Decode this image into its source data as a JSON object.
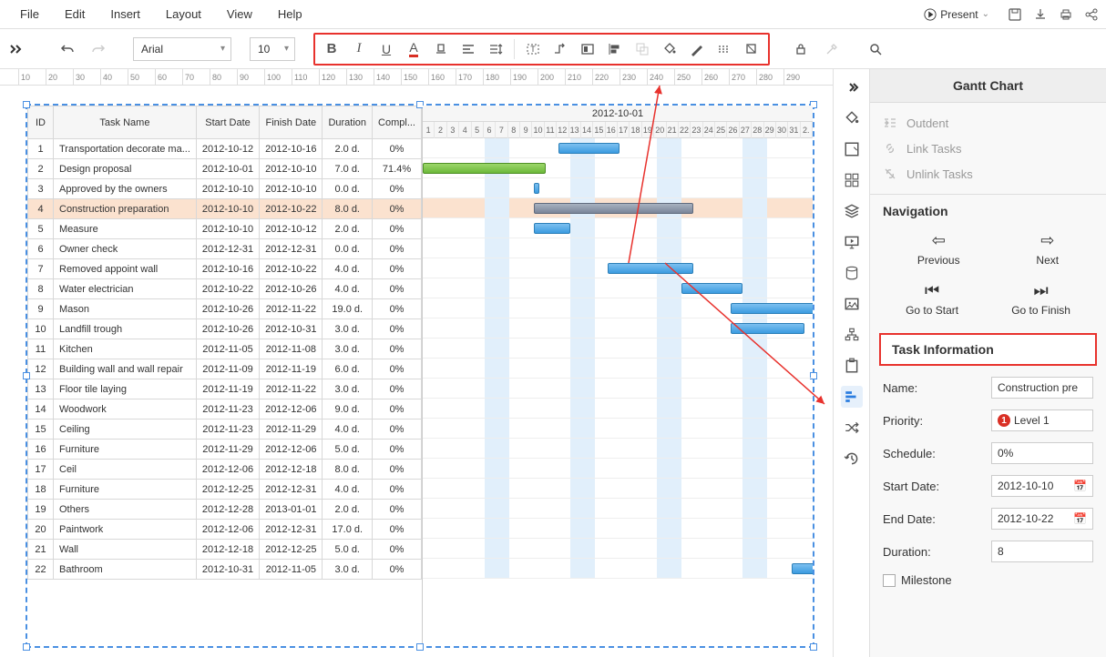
{
  "menu": {
    "file": "File",
    "edit": "Edit",
    "insert": "Insert",
    "layout": "Layout",
    "view": "View",
    "help": "Help",
    "present": "Present"
  },
  "toolbar": {
    "font": "Arial",
    "size": "10"
  },
  "ruler": [
    "10",
    "20",
    "30",
    "40",
    "50",
    "60",
    "70",
    "80",
    "90",
    "100",
    "110",
    "120",
    "130",
    "140",
    "150",
    "160",
    "170",
    "180",
    "190",
    "200",
    "210",
    "220",
    "230",
    "240",
    "250",
    "260",
    "270",
    "280",
    "290"
  ],
  "gantt": {
    "headers": {
      "id": "ID",
      "name": "Task Name",
      "start": "Start Date",
      "finish": "Finish Date",
      "duration": "Duration",
      "complete": "Compl..."
    },
    "month": "2012-10-01",
    "days": [
      "1",
      "2",
      "3",
      "4",
      "5",
      "6",
      "7",
      "8",
      "9",
      "10",
      "11",
      "12",
      "13",
      "14",
      "15",
      "16",
      "17",
      "18",
      "19",
      "20",
      "21",
      "22",
      "23",
      "24",
      "25",
      "26",
      "27",
      "28",
      "29",
      "30",
      "31"
    ],
    "rightEdgeDay": "2.",
    "rows": [
      {
        "id": "1",
        "name": "Transportation decorate ma...",
        "start": "2012-10-12",
        "finish": "2012-10-16",
        "dur": "2.0 d.",
        "comp": "0%",
        "barStart": 12,
        "barLen": 5,
        "barType": "blue"
      },
      {
        "id": "2",
        "name": "Design proposal",
        "start": "2012-10-01",
        "finish": "2012-10-10",
        "dur": "7.0 d.",
        "comp": "71.4%",
        "barStart": 1,
        "barLen": 10,
        "barType": "green"
      },
      {
        "id": "3",
        "name": "Approved by the owners",
        "start": "2012-10-10",
        "finish": "2012-10-10",
        "dur": "0.0 d.",
        "comp": "0%",
        "barStart": 10,
        "barLen": 0.5,
        "barType": "blue"
      },
      {
        "id": "4",
        "name": "Construction preparation",
        "start": "2012-10-10",
        "finish": "2012-10-22",
        "dur": "8.0 d.",
        "comp": "0%",
        "barStart": 10,
        "barLen": 13,
        "barType": "gray",
        "selected": true
      },
      {
        "id": "5",
        "name": "Measure",
        "start": "2012-10-10",
        "finish": "2012-10-12",
        "dur": "2.0 d.",
        "comp": "0%",
        "barStart": 10,
        "barLen": 3,
        "barType": "blue"
      },
      {
        "id": "6",
        "name": "Owner check",
        "start": "2012-12-31",
        "finish": "2012-12-31",
        "dur": "0.0 d.",
        "comp": "0%"
      },
      {
        "id": "7",
        "name": "Removed appoint wall",
        "start": "2012-10-16",
        "finish": "2012-10-22",
        "dur": "4.0 d.",
        "comp": "0%",
        "barStart": 16,
        "barLen": 7,
        "barType": "blue"
      },
      {
        "id": "8",
        "name": "Water electrician",
        "start": "2012-10-22",
        "finish": "2012-10-26",
        "dur": "4.0 d.",
        "comp": "0%",
        "barStart": 22,
        "barLen": 5,
        "barType": "blue"
      },
      {
        "id": "9",
        "name": "Mason",
        "start": "2012-10-26",
        "finish": "2012-11-22",
        "dur": "19.0 d.",
        "comp": "0%",
        "barStart": 26,
        "barLen": 7,
        "barType": "blue"
      },
      {
        "id": "10",
        "name": "Landfill trough",
        "start": "2012-10-26",
        "finish": "2012-10-31",
        "dur": "3.0 d.",
        "comp": "0%",
        "barStart": 26,
        "barLen": 6,
        "barType": "blue"
      },
      {
        "id": "11",
        "name": "Kitchen",
        "start": "2012-11-05",
        "finish": "2012-11-08",
        "dur": "3.0 d.",
        "comp": "0%"
      },
      {
        "id": "12",
        "name": "Building wall and wall repair",
        "start": "2012-11-09",
        "finish": "2012-11-19",
        "dur": "6.0 d.",
        "comp": "0%"
      },
      {
        "id": "13",
        "name": "Floor tile laying",
        "start": "2012-11-19",
        "finish": "2012-11-22",
        "dur": "3.0 d.",
        "comp": "0%"
      },
      {
        "id": "14",
        "name": "Woodwork",
        "start": "2012-11-23",
        "finish": "2012-12-06",
        "dur": "9.0 d.",
        "comp": "0%"
      },
      {
        "id": "15",
        "name": "Ceiling",
        "start": "2012-11-23",
        "finish": "2012-11-29",
        "dur": "4.0 d.",
        "comp": "0%"
      },
      {
        "id": "16",
        "name": "Furniture",
        "start": "2012-11-29",
        "finish": "2012-12-06",
        "dur": "5.0 d.",
        "comp": "0%"
      },
      {
        "id": "17",
        "name": "Ceil",
        "start": "2012-12-06",
        "finish": "2012-12-18",
        "dur": "8.0 d.",
        "comp": "0%"
      },
      {
        "id": "18",
        "name": "Furniture",
        "start": "2012-12-25",
        "finish": "2012-12-31",
        "dur": "4.0 d.",
        "comp": "0%"
      },
      {
        "id": "19",
        "name": "Others",
        "start": "2012-12-28",
        "finish": "2013-01-01",
        "dur": "2.0 d.",
        "comp": "0%"
      },
      {
        "id": "20",
        "name": "Paintwork",
        "start": "2012-12-06",
        "finish": "2012-12-31",
        "dur": "17.0 d.",
        "comp": "0%"
      },
      {
        "id": "21",
        "name": "Wall",
        "start": "2012-12-18",
        "finish": "2012-12-25",
        "dur": "5.0 d.",
        "comp": "0%"
      },
      {
        "id": "22",
        "name": "Bathroom",
        "start": "2012-10-31",
        "finish": "2012-11-05",
        "dur": "3.0 d.",
        "comp": "0%",
        "barStart": 31,
        "barLen": 2,
        "barType": "blue"
      }
    ]
  },
  "panel": {
    "title": "Gantt Chart",
    "outdent": "Outdent",
    "linkTasks": "Link Tasks",
    "unlinkTasks": "Unlink Tasks",
    "navigation": "Navigation",
    "previous": "Previous",
    "next": "Next",
    "goStart": "Go to Start",
    "goFinish": "Go to Finish",
    "taskInfo": "Task Information",
    "name": "Name:",
    "nameVal": "Construction pre",
    "priority": "Priority:",
    "priorityVal": "Level 1",
    "schedule": "Schedule:",
    "scheduleVal": "0%",
    "startDate": "Start Date:",
    "startDateVal": "2012-10-10",
    "endDate": "End Date:",
    "endDateVal": "2012-10-22",
    "duration": "Duration:",
    "durationVal": "8",
    "milestone": "Milestone"
  }
}
